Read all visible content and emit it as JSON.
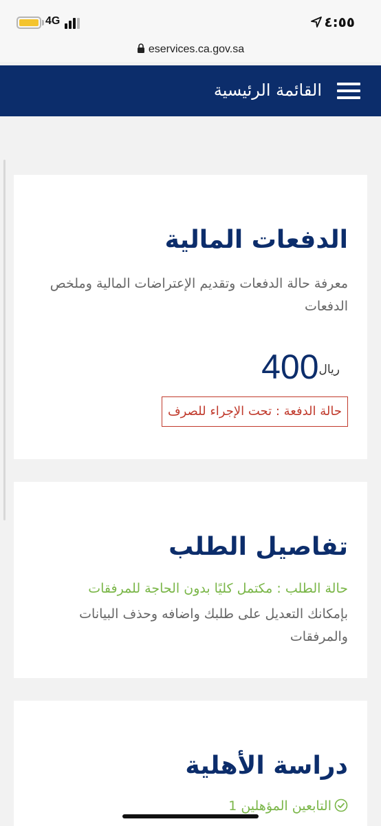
{
  "status_bar": {
    "network": "4G",
    "time": "٤:٥٥",
    "url": "eservices.ca.gov.sa"
  },
  "header": {
    "menu_label": "القائمة الرئيسية"
  },
  "payments_card": {
    "title": "الدفعات المالية",
    "description": "معرفة حالة الدفعات وتقديم الإعتراضات المالية وملخص الدفعات",
    "amount": "400",
    "currency": "ريال",
    "status": "حالة الدفعة : تحت الإجراء للصرف"
  },
  "request_card": {
    "title": "تفاصيل الطلب",
    "status": "حالة الطلب : مكتمل كليًا بدون الحاجة للمرفقات",
    "description": "بإمكانك التعديل على طلبك واضافه وحذف البيانات والمرفقات"
  },
  "eligibility_card": {
    "title": "دراسة الأهلية",
    "dependents": "التابعين المؤهلين 1"
  },
  "colors": {
    "primary": "#0c2d6b",
    "status_red": "#c0392b",
    "status_green": "#7ab648"
  }
}
